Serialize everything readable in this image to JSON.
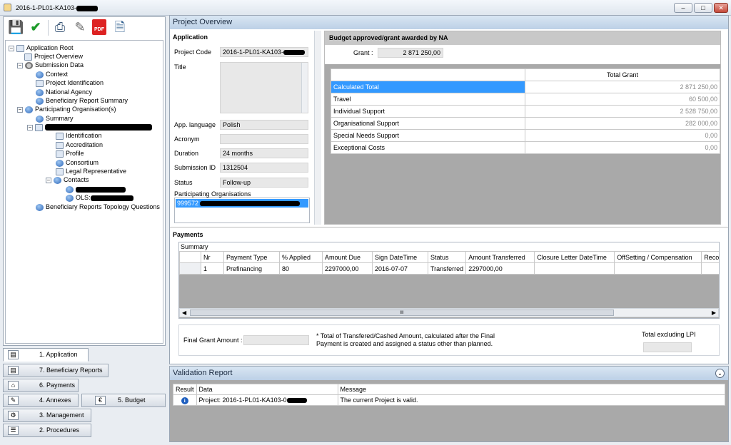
{
  "window": {
    "title": "2016-1-PL01-KA103-",
    "controls": [
      "minimize",
      "maximize",
      "close"
    ]
  },
  "toolbar": {
    "icons": [
      "save-icon",
      "check-icon",
      "print-icon",
      "edit-icon",
      "pdf-icon",
      "export-icon"
    ],
    "pdf_label": "PDF"
  },
  "tree": {
    "root": "Application Root",
    "project_overview": "Project Overview",
    "submission_data": "Submission Data",
    "context": "Context",
    "project_identification": "Project Identification",
    "national_agency": "National Agency",
    "beneficiary_report_summary": "Beneficiary Report Summary",
    "participating_organisations": "Participating Organisation(s)",
    "summary": "Summary",
    "identification": "Identification",
    "accreditation": "Accreditation",
    "profile": "Profile",
    "consortium": "Consortium",
    "legal_representative": "Legal Representative",
    "contacts": "Contacts",
    "ols_prefix": "OLS:",
    "topology": "Beneficiary Reports Topology Questions"
  },
  "nav": {
    "application": "1. Application",
    "beneficiary_reports": "7. Beneficiary Reports",
    "payments": "6. Payments",
    "annexes": "4. Annexes",
    "budget": "5. Budget",
    "management": "3. Management",
    "procedures": "2. Procedures"
  },
  "overview": {
    "header": "Project Overview",
    "application_title": "Application",
    "project_code_label": "Project Code",
    "project_code": "2016-1-PL01-KA103-",
    "title_label": "Title",
    "title_value": "",
    "app_language_label": "App. language",
    "app_language": "Polish",
    "acronym_label": "Acronym",
    "acronym": "",
    "duration_label": "Duration",
    "duration": "24 months",
    "submission_id_label": "Submission ID",
    "submission_id": "1312504",
    "status_label": "Status",
    "status": "Follow-up",
    "participating_label": "Participating Organisations",
    "participating_value": "999572"
  },
  "budget": {
    "title": "Budget approved/grant awarded by NA",
    "grant_label": "Grant :",
    "grant_value": "2 871 250,00",
    "column": "Total Grant",
    "rows": [
      {
        "name": "Calculated Total",
        "value": "2 871 250,00"
      },
      {
        "name": "Travel",
        "value": "60 500,00"
      },
      {
        "name": "Individual Support",
        "value": "2 528 750,00"
      },
      {
        "name": "Organisational Support",
        "value": "282 000,00"
      },
      {
        "name": "Special Needs Support",
        "value": "0,00"
      },
      {
        "name": "Exceptional Costs",
        "value": "0,00"
      }
    ]
  },
  "payments": {
    "title": "Payments",
    "summary_label": "Summary",
    "columns": [
      "Nr",
      "Payment Type",
      "% Applied",
      "Amount Due",
      "Sign DateTime",
      "Status",
      "Amount Transferred",
      "Closure Letter DateTime",
      "OffSetting / Compensation",
      "Reco"
    ],
    "rows": [
      {
        "nr": "1",
        "type": "Prefinancing",
        "applied": "80",
        "due": "2297000,00",
        "sign": "2016-07-07",
        "status": "Transferred",
        "transferred": "2297000,00",
        "closure": "",
        "offsetting": "",
        "reco": ""
      }
    ],
    "scroll_grip": "III",
    "final_grant_label": "Final Grant Amount :",
    "final_grant_value": "",
    "note_line1": "* Total of Transfered/Cashed Amount, calculated after the Final",
    "note_line2": "Payment is created and assigned a status other than planned.",
    "total_excl_label": "Total excluding LPI",
    "total_excl_value": ""
  },
  "validation": {
    "header": "Validation Report",
    "columns": [
      "Result",
      "Data",
      "Message"
    ],
    "rows": [
      {
        "icon": "info-icon",
        "data": "Project: 2016-1-PL01-KA103-0",
        "message": "The current Project is valid."
      }
    ]
  },
  "colors": {
    "selection": "#3399ff",
    "header_gradient_top": "#d9e6f3",
    "header_gradient_bottom": "#bcd0e6",
    "grid_empty": "#a9a9a9"
  }
}
